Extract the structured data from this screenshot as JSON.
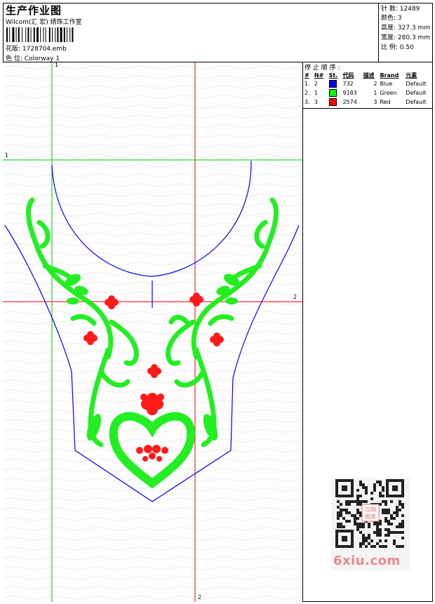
{
  "header": {
    "title": "生产作业图",
    "company": "Wilcom(汇 宏) 绣饰工作室",
    "design_label": "花版:",
    "design_value": "1728704.emb",
    "colorway_label": "色 位:",
    "colorway_value": "Colorway 1"
  },
  "stats": [
    {
      "label": "针 数:",
      "value": "12489"
    },
    {
      "label": "颜色:",
      "value": "3"
    },
    {
      "label": "高度:",
      "value": "327.3 mm"
    },
    {
      "label": "宽度:",
      "value": "280.3 mm"
    },
    {
      "label": "比 例:",
      "value": "0.50"
    }
  ],
  "stop_sequence": {
    "title": "停 止 顺 序 :",
    "columns": [
      "#",
      "N#",
      "St.",
      "代码",
      "描述",
      "Brand",
      "元素"
    ],
    "rows": [
      {
        "order": "1.",
        "n": "2",
        "color": "#0000ff",
        "stitches": "732",
        "code": "2",
        "desc": "Blue",
        "brand": "Default"
      },
      {
        "order": "2.",
        "n": "1",
        "color": "#00ff00",
        "stitches": "9183",
        "code": "1",
        "desc": "Green",
        "brand": "Default"
      },
      {
        "order": "3.",
        "n": "3",
        "color": "#ff0000",
        "stitches": "2574",
        "code": "3",
        "desc": "Red",
        "brand": "Default"
      }
    ]
  },
  "guides": {
    "v1": "1",
    "h1": "1",
    "h2": "2",
    "v2": "2"
  },
  "watermark": "6xiu.com",
  "qr_stamp": "汉翔图库",
  "colors": {
    "blue": "#0000ff",
    "green": "#00ff00",
    "red": "#ff0000",
    "guide_green": "#00cc00",
    "guide_red": "#ff0000"
  }
}
